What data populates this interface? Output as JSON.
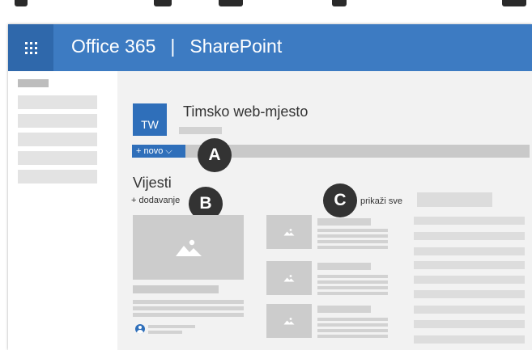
{
  "suitebar": {
    "app_name": "Office 365",
    "separator": "|",
    "product": "SharePoint",
    "waffle_icon": "app-launcher-icon"
  },
  "site": {
    "logo_text": "TW",
    "title": "Timsko web-mjesto"
  },
  "commandbar": {
    "new_label": "+ novo ⌵"
  },
  "news": {
    "heading": "Vijesti",
    "add_label": "+ dodavanje",
    "show_all_label": "prikaži sve"
  },
  "callouts": {
    "a": "A",
    "b": "B",
    "c": "C"
  },
  "colors": {
    "suitebar": "#3d7bc2",
    "waffle": "#2f68ab",
    "accent": "#2f6fba",
    "callout": "#333333",
    "canvas": "#f2f2f2"
  }
}
